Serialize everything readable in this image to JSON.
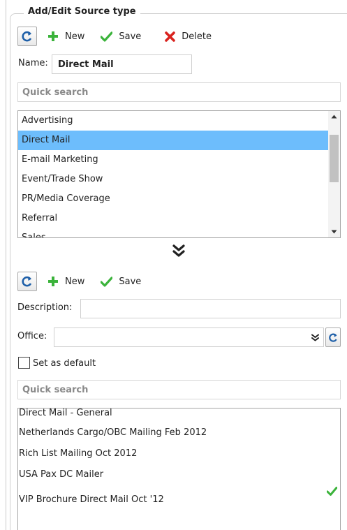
{
  "source_type": {
    "legend": "Add/Edit Source type",
    "toolbar": {
      "new_label": "New",
      "save_label": "Save",
      "delete_label": "Delete"
    },
    "name_label": "Name:",
    "name_value": "Direct Mail",
    "search_placeholder": "Quick search",
    "items": [
      "Advertising",
      "Direct Mail",
      "E-mail Marketing",
      "Event/Trade Show",
      "PR/Media Coverage",
      "Referral",
      "Sales"
    ],
    "selected_item": "Direct Mail"
  },
  "detail": {
    "toolbar": {
      "new_label": "New",
      "save_label": "Save"
    },
    "description_label": "Description:",
    "description_value": "",
    "office_label": "Office:",
    "office_value": "",
    "default_label": "Set as default",
    "default_checked": false,
    "search_placeholder": "Quick search",
    "items": [
      "Direct Mail - General",
      "Netherlands Cargo/OBC Mailing Feb 2012",
      "Rich List Mailing Oct 2012",
      "USA Pax DC Mailer",
      "VIP Brochure Direct Mail Oct '12"
    ],
    "checked_item": "VIP Brochure Direct Mail Oct '12"
  },
  "colors": {
    "selection": "#6dbdfc",
    "accent_green": "#3bb33b",
    "delete_red": "#d9231f",
    "refresh_blue": "#1e5fa8"
  }
}
